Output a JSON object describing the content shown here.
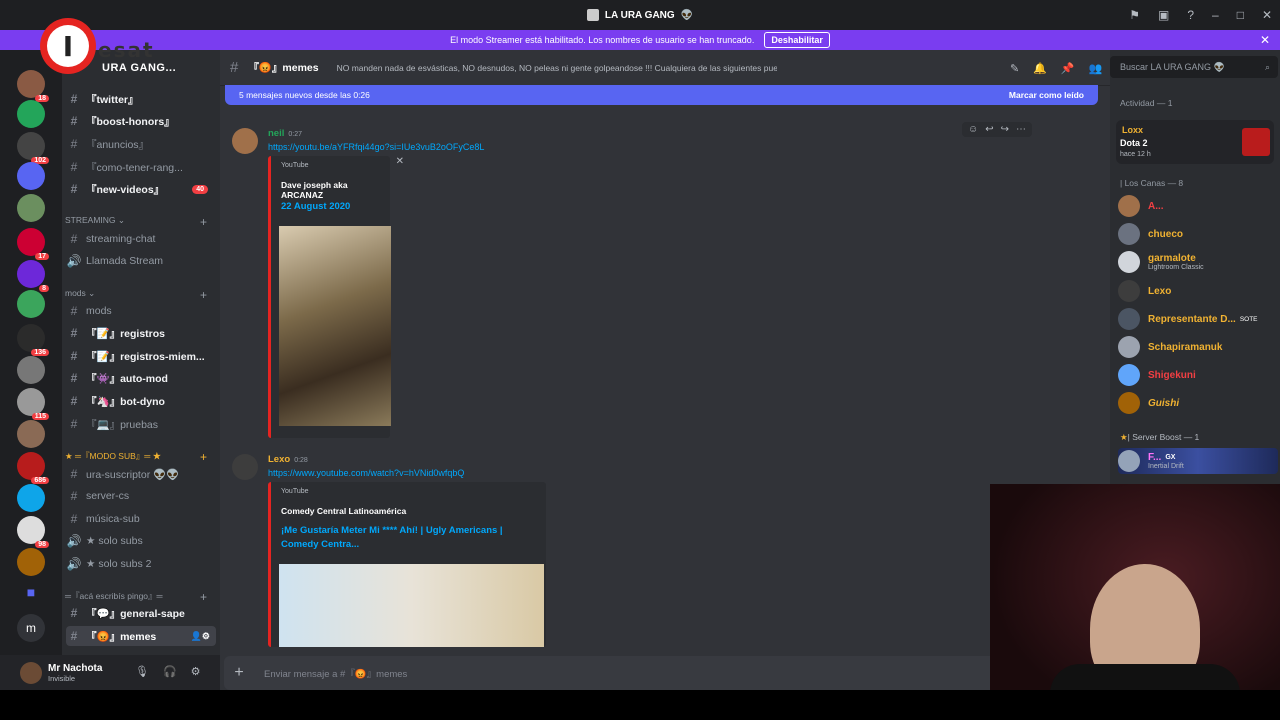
{
  "window": {
    "title": "LA URA GANG",
    "title_emoji": "👽"
  },
  "banner": {
    "text": "El modo Streamer está habilitado. Los nombres de usuario se han truncado.",
    "button": "Deshabilitar"
  },
  "overlay_logo": {
    "letter": "I",
    "text": "esat"
  },
  "server": {
    "name": "URA GANG..."
  },
  "server_badges": [
    "18",
    "102",
    "17",
    "8",
    "136",
    "115",
    "686",
    "98"
  ],
  "channels": [
    {
      "label": "『twitter』",
      "bold": true
    },
    {
      "label": "『boost-honors』",
      "bold": true
    },
    {
      "label": "『anuncios』",
      "bold": false
    },
    {
      "label": "『como-tener-rang...",
      "bold": false
    },
    {
      "label": "『new-videos』",
      "bold": true,
      "badge": "40"
    }
  ],
  "category_streaming": "STREAMING",
  "streaming_channels": [
    "streaming-chat",
    "Llamada Stream"
  ],
  "category_mods": "mods",
  "mods_channels": [
    {
      "label": "mods",
      "bold": false
    },
    {
      "label": "『📝』registros",
      "bold": true
    },
    {
      "label": "『📝』registros-miem...",
      "bold": true
    },
    {
      "label": "『👾』auto-mod",
      "bold": true
    },
    {
      "label": "『🦄』bot-dyno",
      "bold": true
    },
    {
      "label": "『💻』pruebas",
      "bold": false
    }
  ],
  "category_modo_sub": "★ ═『MODO SUB』═ ★",
  "sub_channels": [
    "ura-suscriptor 👽👽",
    "server-cs",
    "música-sub",
    "★ solo subs",
    "★ solo subs 2"
  ],
  "category_aca": "═『acá escribís pingo』═",
  "aca_channels": [
    {
      "label": "『💬』general-sape",
      "bold": true
    },
    {
      "label": "『😡』memes",
      "bold": true,
      "selected": true
    }
  ],
  "user": {
    "name": "Mr Nachota",
    "status": "Invisible"
  },
  "channel_header": {
    "name": "『😡』memes",
    "topic": "NO manden nada de esvásticas, NO desnudos, NO peleas ni gente golpeandose !!! Cualquiera de las siguientes puede ser motivo de BAN, cuiden el stream!"
  },
  "new_messages": {
    "text": "5 mensajes nuevos desde las 0:26",
    "mark": "Marcar como leído"
  },
  "messages": [
    {
      "author": "neil",
      "time": "0:27",
      "link": "https://youtu.be/aYFRfqi44go?si=IUe3vuB2oOFyCe8L",
      "embed": {
        "provider": "YouTube",
        "author": "Dave joseph aka ARCANAZ",
        "title": "22 August 2020"
      }
    },
    {
      "author": "Lexo",
      "time": "0:28",
      "link": "https://www.youtube.com/watch?v=hVNid0wfqbQ",
      "embed": {
        "provider": "YouTube",
        "author": "Comedy Central Latinoamérica",
        "title": "¡Me Gustaría Meter Mi **** Ahí! | Ugly Americans | Comedy Centra..."
      }
    }
  ],
  "composer": {
    "placeholder": "Enviar mensaje a #『😡』memes"
  },
  "search": {
    "placeholder": "Buscar LA URA GANG 👽"
  },
  "members": {
    "activity_header": "Actividad — 1",
    "activity": {
      "name": "Loxx",
      "game": "Dota 2",
      "time": "hace 12 h"
    },
    "group1_header": "| Los Canas — 8",
    "group1": [
      {
        "name": "A...",
        "color": "#f23f43",
        "sub": ""
      },
      {
        "name": "chueco",
        "color": "#f0b232",
        "sub": ""
      },
      {
        "name": "garmalote",
        "color": "#f0b232",
        "sub": "Lightroom Classic"
      },
      {
        "name": "Lexo",
        "color": "#f0b232",
        "sub": ""
      },
      {
        "name": "Representante D...",
        "color": "#f0b232",
        "sub": "",
        "tag": "SOTE"
      },
      {
        "name": "Schapiramanuk",
        "color": "#f0b232",
        "sub": ""
      },
      {
        "name": "Shigekuni",
        "color": "#f23f43",
        "sub": ""
      },
      {
        "name": "Guishi",
        "color": "#f0b232",
        "sub": "",
        "italic": true
      }
    ],
    "group2_header": "| Server Boost — 1",
    "group2": [
      {
        "name": "F...",
        "color": "#ff73fa",
        "sub": "Inertial Drift",
        "tag": "GX"
      }
    ]
  },
  "colors": {
    "accent": "#5865f2",
    "banner": "#7a3df0",
    "link": "#00a8fc",
    "youtube": "#e52421"
  }
}
